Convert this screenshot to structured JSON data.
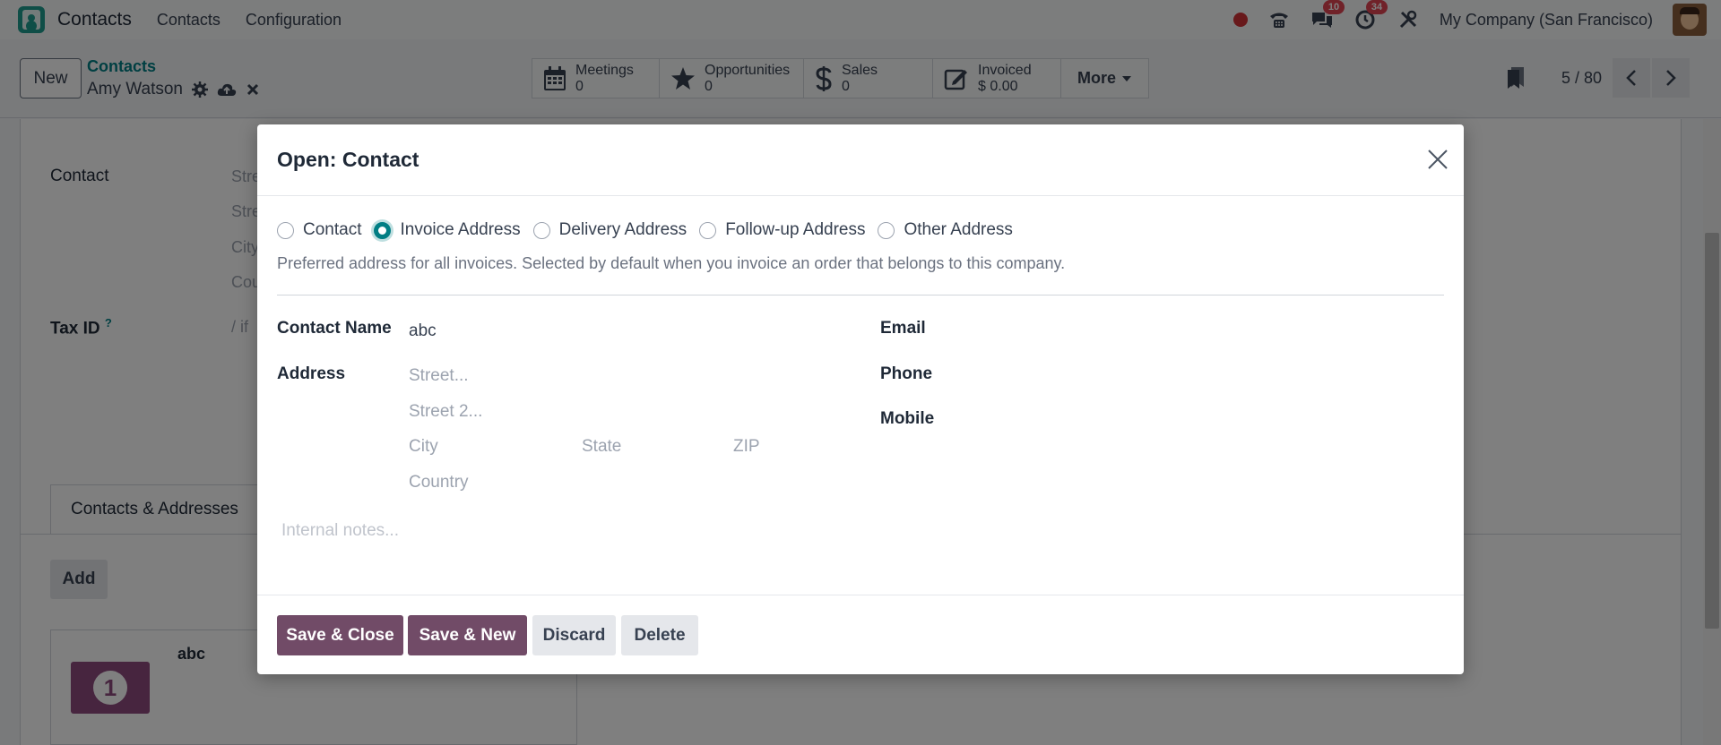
{
  "navbar": {
    "app_name": "Contacts",
    "menus": [
      "Contacts",
      "Configuration"
    ],
    "chat_badge": "10",
    "activity_badge": "34",
    "company": "My Company (San Francisco)"
  },
  "control": {
    "new_label": "New",
    "breadcrumb_parent": "Contacts",
    "breadcrumb_current": "Amy Watson",
    "smart_buttons": [
      {
        "label": "Meetings",
        "value": "0",
        "icon": "calendar-icon"
      },
      {
        "label": "Opportunities",
        "value": "0",
        "icon": "star-icon"
      },
      {
        "label": "Sales",
        "value": "0",
        "icon": "dollar-icon"
      },
      {
        "label": "Invoiced",
        "value": "$ 0.00",
        "icon": "invoice-icon"
      }
    ],
    "more_label": "More",
    "pager": "5 / 80"
  },
  "background_form": {
    "contact_label": "Contact",
    "address_lines": [
      "Stre",
      "Stre",
      "City",
      "Cou"
    ],
    "tax_id_label": "Tax ID",
    "tax_id_help": "?",
    "tax_id_placeholder": "/ if",
    "tab_label": "Contacts & Addresses",
    "add_label": "Add",
    "card_name": "abc"
  },
  "modal": {
    "title": "Open: Contact",
    "address_types": [
      "Contact",
      "Invoice Address",
      "Delivery Address",
      "Follow-up Address",
      "Other Address"
    ],
    "selected_type": "Invoice Address",
    "help_text": "Preferred address for all invoices. Selected by default when you invoice an order that belongs to this company.",
    "contact_name_label": "Contact Name",
    "contact_name_value": "abc",
    "address_label": "Address",
    "street_placeholder": "Street...",
    "street2_placeholder": "Street 2...",
    "city_placeholder": "City",
    "state_placeholder": "State",
    "zip_placeholder": "ZIP",
    "country_placeholder": "Country",
    "email_label": "Email",
    "phone_label": "Phone",
    "mobile_label": "Mobile",
    "notes_placeholder": "Internal notes...",
    "buttons": {
      "save_close": "Save & Close",
      "save_new": "Save & New",
      "discard": "Discard",
      "delete": "Delete"
    }
  },
  "colors": {
    "primary": "#714b67",
    "teal": "#017e84",
    "badge": "#e04452"
  }
}
